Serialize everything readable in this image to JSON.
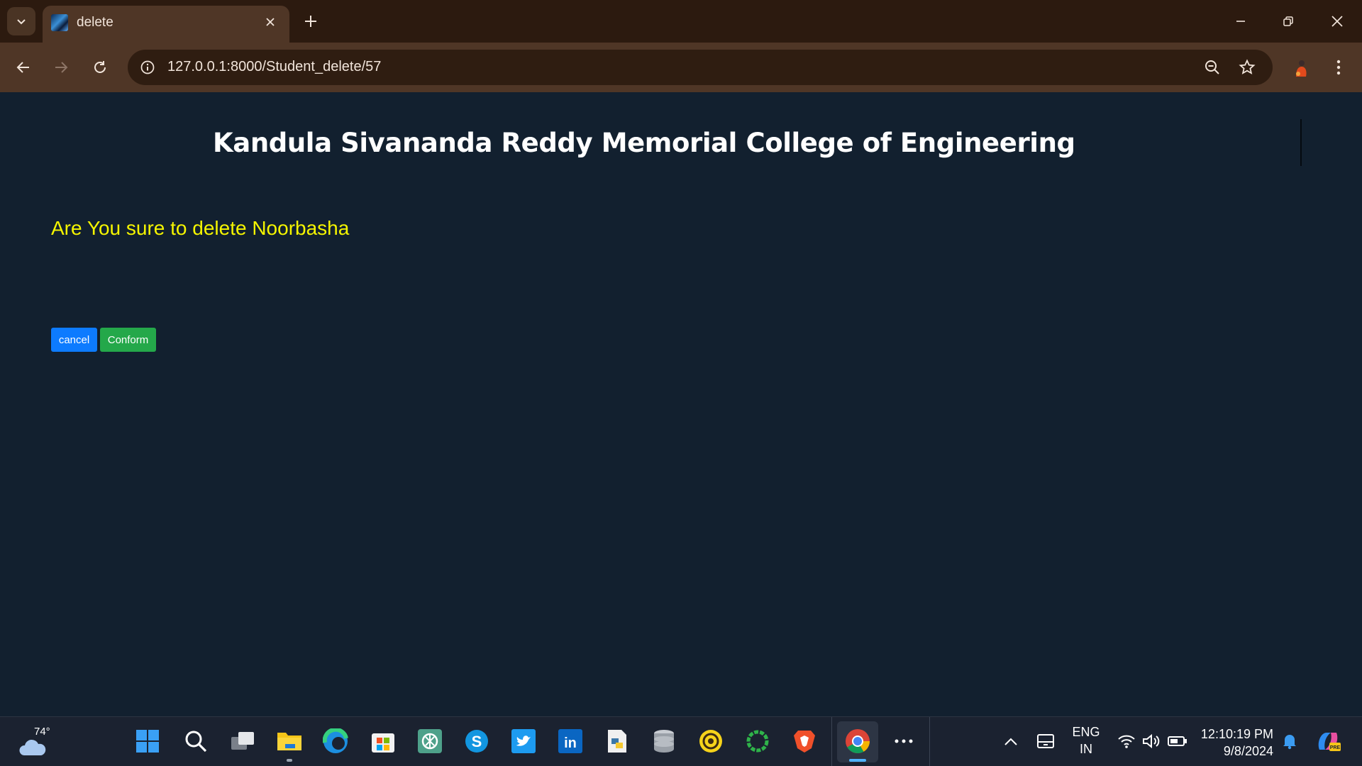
{
  "browser": {
    "tab": {
      "title": "delete"
    },
    "address_bar": {
      "url": "127.0.0.1:8000/Student_delete/57"
    }
  },
  "page": {
    "header": {
      "title": "Kandula Sivananda Reddy Memorial College of Engineering"
    },
    "message": "Are You sure to delete Noorbasha",
    "buttons": {
      "cancel_label": "cancel",
      "confirm_label": "Conform"
    },
    "colors": {
      "background": "#12202f",
      "message": "#f5f500",
      "cancel": "#0d7bff",
      "confirm": "#24a84a"
    }
  },
  "taskbar": {
    "weather": {
      "temperature": "74°"
    },
    "apps": [
      "windows-start",
      "search",
      "task-view",
      "file-explorer",
      "edge",
      "microsoft-store",
      "chatgpt",
      "skype",
      "twitter",
      "linkedin",
      "python-idle",
      "database",
      "codechef",
      "green-app",
      "brave",
      "chrome"
    ],
    "tray": {
      "language": "ENG",
      "region": "IN",
      "time": "12:10:19 PM",
      "date": "9/8/2024"
    }
  }
}
